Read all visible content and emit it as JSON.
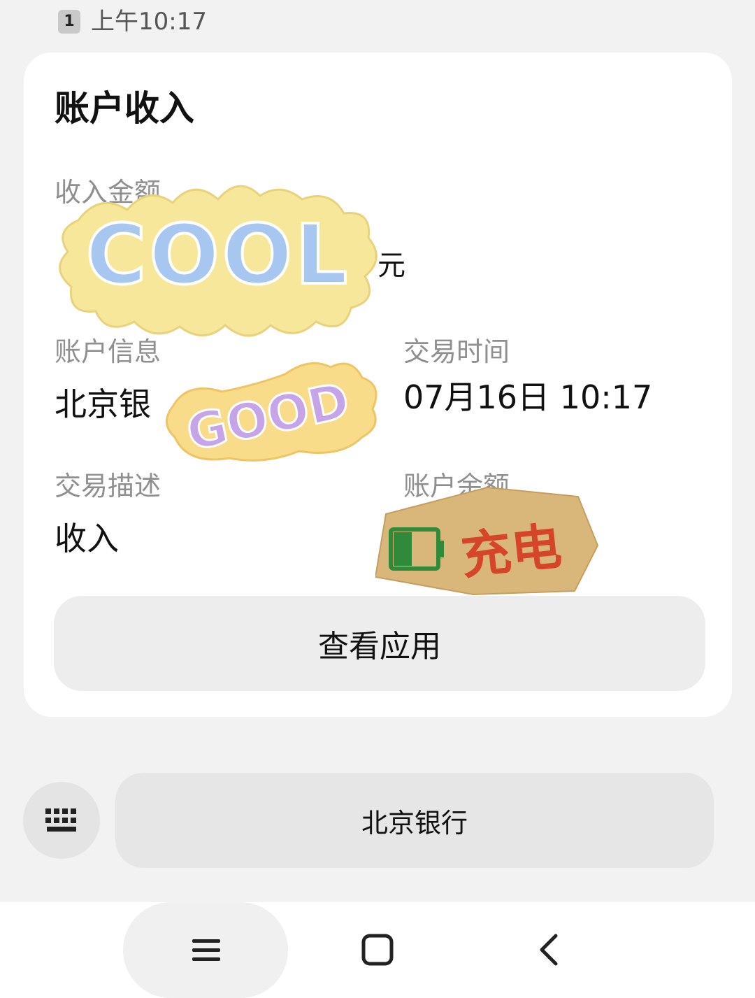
{
  "status_bar": {
    "sim_slot": "1",
    "time": "上午10:17"
  },
  "card": {
    "title": "账户收入",
    "fields": {
      "amount_label": "收入金额",
      "amount_unit": "元",
      "account_label": "账户信息",
      "account_value": "北京银",
      "time_label": "交易时间",
      "time_value": "07月16日 10:17",
      "desc_label": "交易描述",
      "desc_value": "收入",
      "balance_label": "账户余额"
    },
    "action_label": "查看应用"
  },
  "stickers": {
    "cool": "COOL",
    "good": "GOOD",
    "charge": "充电"
  },
  "reply_bar": {
    "keyboard_icon": "keyboard-icon",
    "quick_reply_label": "北京银行"
  },
  "nav_bar": {
    "icons": [
      "menu-icon",
      "home-square-icon",
      "back-chevron-icon"
    ]
  },
  "colors": {
    "background": "#f2f2f2",
    "card": "#ffffff",
    "label_gray": "#8f8f8f",
    "button_gray": "#ededed",
    "sticker_yellow": "#f7e79a",
    "charge_red": "#d4452a",
    "charge_green": "#2f8a3a",
    "charge_paper": "#d9b77a"
  }
}
